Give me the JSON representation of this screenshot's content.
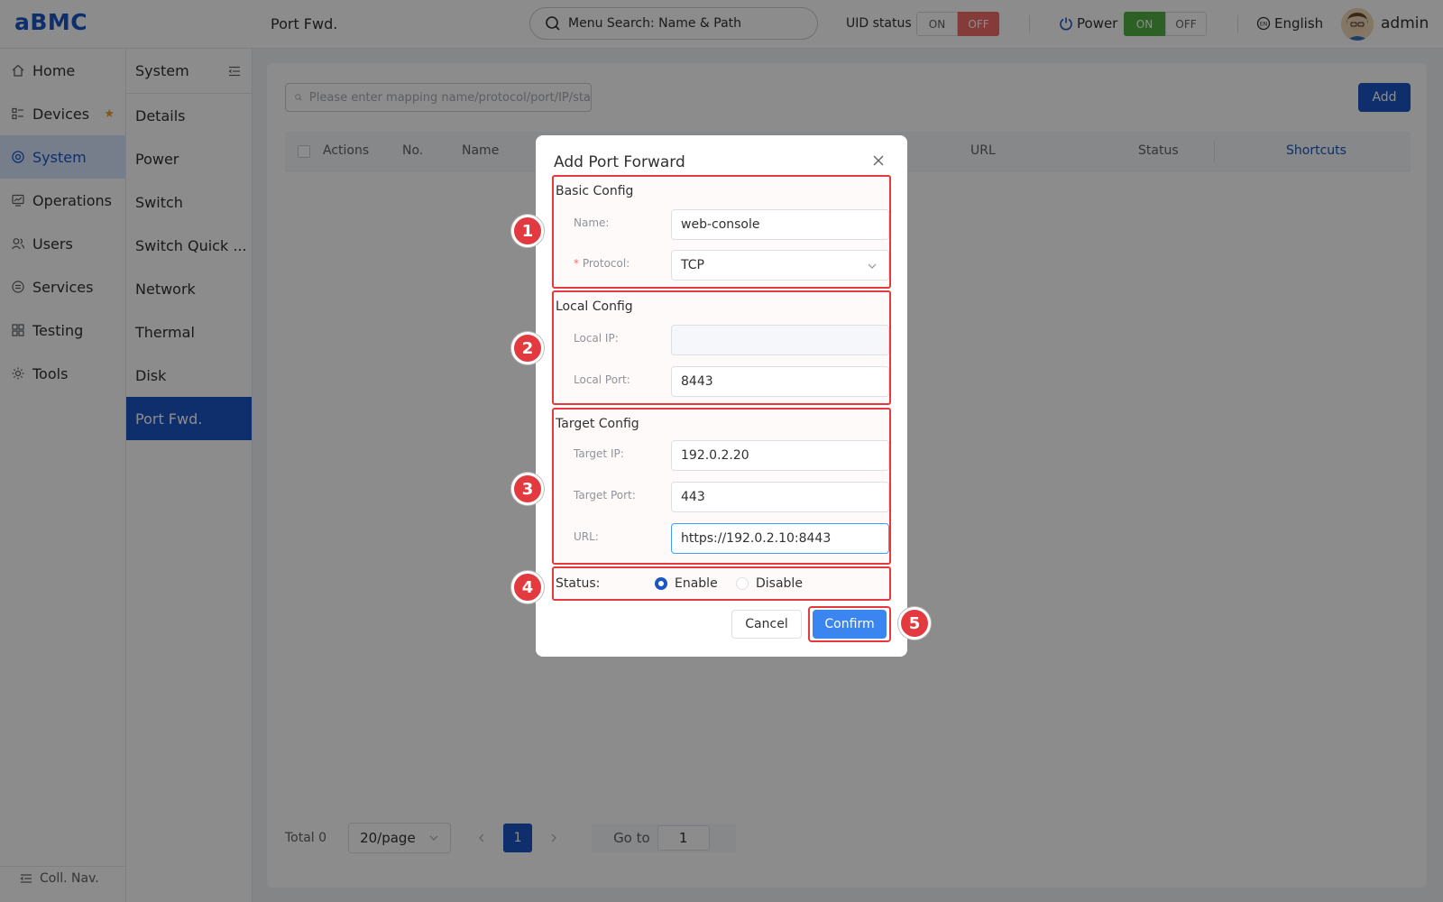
{
  "header": {
    "logo": "aBMC",
    "page_title": "Port Fwd.",
    "menu_search_placeholder": "Menu Search: Name & Path",
    "uid_label": "UID status",
    "uid_on": "ON",
    "uid_off": "OFF",
    "power_label": "Power",
    "power_on": "ON",
    "power_off": "OFF",
    "language": "English",
    "user": "admin"
  },
  "nav_primary": {
    "items": [
      {
        "label": "Home",
        "icon": "home-icon"
      },
      {
        "label": "Devices",
        "icon": "devices-icon"
      },
      {
        "label": "System",
        "icon": "system-icon"
      },
      {
        "label": "Operations",
        "icon": "operations-icon"
      },
      {
        "label": "Users",
        "icon": "users-icon"
      },
      {
        "label": "Services",
        "icon": "services-icon"
      },
      {
        "label": "Testing",
        "icon": "testing-icon"
      },
      {
        "label": "Tools",
        "icon": "tools-icon"
      }
    ],
    "active": "System",
    "collapse_label": "Coll. Nav."
  },
  "nav_secondary": {
    "title": "System",
    "items": [
      "Details",
      "Power",
      "Switch",
      "Switch Quick ...",
      "Network",
      "Thermal",
      "Disk",
      "Port Fwd."
    ],
    "active": "Port Fwd."
  },
  "content": {
    "search_placeholder": "Please enter mapping name/protocol/port/IP/sta",
    "add_label": "Add",
    "columns": [
      "Actions",
      "No.",
      "Name",
      "URL",
      "Status",
      "Shortcuts"
    ],
    "pager": {
      "total": "Total 0",
      "page_size": "20/page",
      "current_page": "1",
      "goto_label": "Go to",
      "goto_value": "1"
    }
  },
  "dialog": {
    "title": "Add Port Forward",
    "basic": {
      "title": "Basic Config",
      "name_label": "Name:",
      "name_value": "web-console",
      "protocol_label": "Protocol:",
      "protocol_value": "TCP"
    },
    "local": {
      "title": "Local Config",
      "ip_label": "Local IP:",
      "ip_value": "",
      "port_label": "Local Port:",
      "port_value": "8443"
    },
    "target": {
      "title": "Target Config",
      "ip_label": "Target IP:",
      "ip_value": "192.0.2.20",
      "port_label": "Target Port:",
      "port_value": "443",
      "url_label": "URL:",
      "url_value": "https://192.0.2.10:8443"
    },
    "status": {
      "label": "Status:",
      "enable": "Enable",
      "disable": "Disable",
      "selected": "Enable"
    },
    "cancel_label": "Cancel",
    "confirm_label": "Confirm"
  },
  "annotations": [
    "1",
    "2",
    "3",
    "4",
    "5"
  ],
  "colors": {
    "brand": "#1a56c4",
    "highlight": "#e5393e",
    "uid_off": "#f56c6c",
    "power_on": "#52b043"
  }
}
